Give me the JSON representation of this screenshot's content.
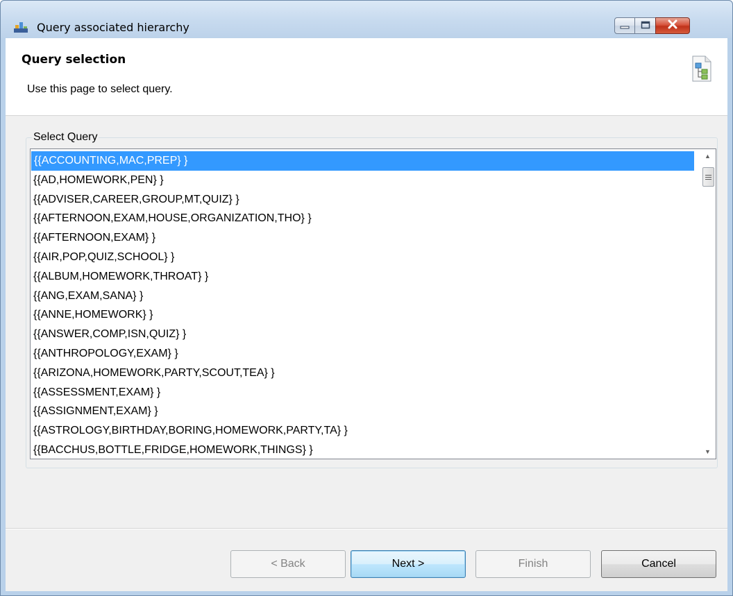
{
  "window": {
    "title": "Query associated hierarchy",
    "icons": {
      "app": "app-icon",
      "minimize": "minimize-icon",
      "maximize": "maximize-icon",
      "close": "close-icon"
    }
  },
  "header": {
    "title": "Query selection",
    "description": "Use this page to select query.",
    "icon": "hierarchy-icon"
  },
  "query_group": {
    "label": "Select Query",
    "selected_index": 0,
    "items": [
      "{{ACCOUNTING,MAC,PREP} }",
      "{{AD,HOMEWORK,PEN} }",
      "{{ADVISER,CAREER,GROUP,MT,QUIZ} }",
      "{{AFTERNOON,EXAM,HOUSE,ORGANIZATION,THO} }",
      "{{AFTERNOON,EXAM} }",
      "{{AIR,POP,QUIZ,SCHOOL} }",
      "{{ALBUM,HOMEWORK,THROAT} }",
      "{{ANG,EXAM,SANA} }",
      "{{ANNE,HOMEWORK} }",
      "{{ANSWER,COMP,ISN,QUIZ} }",
      "{{ANTHROPOLOGY,EXAM} }",
      "{{ARIZONA,HOMEWORK,PARTY,SCOUT,TEA} }",
      "{{ASSESSMENT,EXAM} }",
      "{{ASSIGNMENT,EXAM} }",
      "{{ASTROLOGY,BIRTHDAY,BORING,HOMEWORK,PARTY,TA} }",
      "{{BACCHUS,BOTTLE,FRIDGE,HOMEWORK,THINGS} }"
    ]
  },
  "buttons": {
    "back": "< Back",
    "next": "Next >",
    "finish": "Finish",
    "cancel": "Cancel"
  },
  "colors": {
    "selection": "#3399ff",
    "dialog_bg": "#f0f0f0",
    "title_bar": "#c8dbef",
    "close_button": "#c73a22"
  }
}
